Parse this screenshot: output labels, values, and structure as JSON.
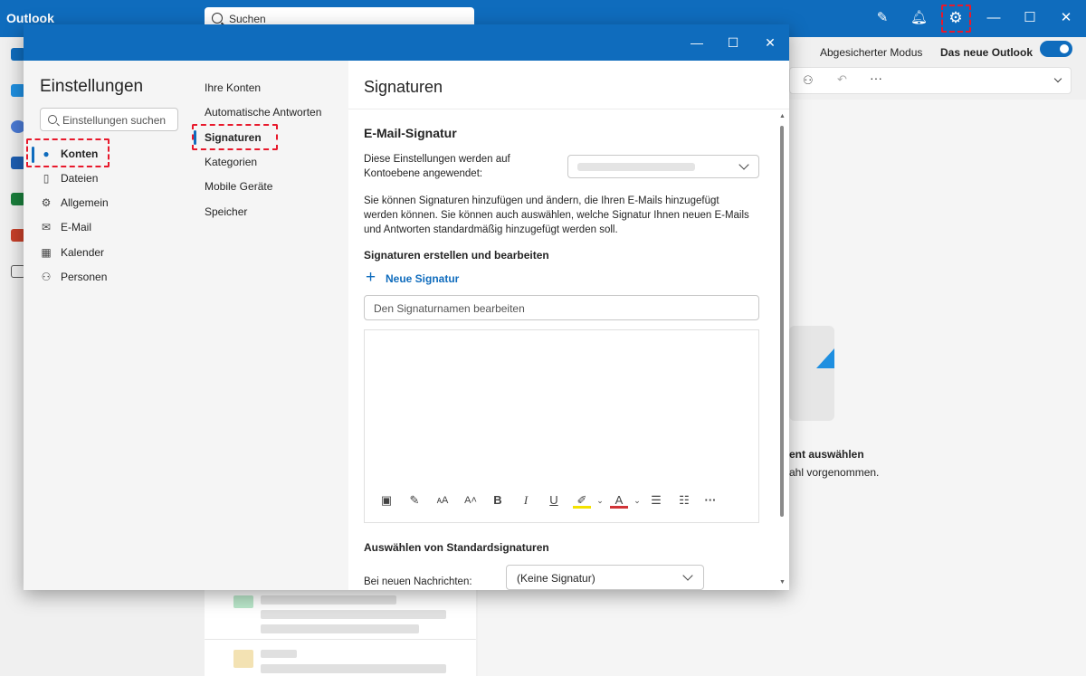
{
  "app": {
    "title": "Outlook",
    "search_placeholder": "Suchen"
  },
  "header": {
    "safe_mode": "Abgesicherter Modus",
    "new_outlook": "Das neue Outlook",
    "new_outlook_toggle": "on"
  },
  "background": {
    "empty_title": "ent auswählen",
    "empty_sub": "ahl vorgenommen."
  },
  "settings": {
    "title": "Einstellungen",
    "search_placeholder": "Einstellungen suchen",
    "categories": [
      {
        "label": "Konten",
        "icon": "person-icon"
      },
      {
        "label": "Dateien",
        "icon": "file-icon"
      },
      {
        "label": "Allgemein",
        "icon": "gear-icon"
      },
      {
        "label": "E-Mail",
        "icon": "mail-icon"
      },
      {
        "label": "Kalender",
        "icon": "calendar-icon"
      },
      {
        "label": "Personen",
        "icon": "people-icon"
      }
    ],
    "subcategories": [
      {
        "label": "Ihre Konten"
      },
      {
        "label": "Automatische Antworten"
      },
      {
        "label": "Signaturen"
      },
      {
        "label": "Kategorien"
      },
      {
        "label": "Mobile Geräte"
      },
      {
        "label": "Speicher"
      }
    ]
  },
  "pane": {
    "title": "Signaturen",
    "section_title": "E-Mail-Signatur",
    "apply_line1": "Diese Einstellungen werden auf",
    "apply_line2": "Kontoebene angewendet:",
    "desc_line1": "Sie können Signaturen hinzufügen und ändern, die Ihren E-Mails hinzugefügt",
    "desc_line2": "werden können. Sie können auch auswählen, welche Signatur Ihnen neuen E-Mails",
    "desc_line3": "und Antworten standardmäßig hinzugefügt werden soll.",
    "create_label": "Signaturen erstellen und bearbeiten",
    "new_signature": "Neue Signatur",
    "name_placeholder": "Den Signaturnamen bearbeiten",
    "defaults_title": "Auswählen von Standardsignaturen",
    "new_messages_label": "Bei neuen Nachrichten:",
    "new_messages_value": "(Keine Signatur)",
    "toolbar": [
      "image-icon",
      "format-painter-icon",
      "font-size-icon",
      "increase-font-icon",
      "bold-icon",
      "italic-icon",
      "underline-icon",
      "highlight-icon",
      "font-color-icon",
      "bullets-icon",
      "numbering-icon",
      "more-icon"
    ]
  },
  "colors": {
    "accent": "#0f6cbd",
    "highlight_border": "#e8192c"
  }
}
